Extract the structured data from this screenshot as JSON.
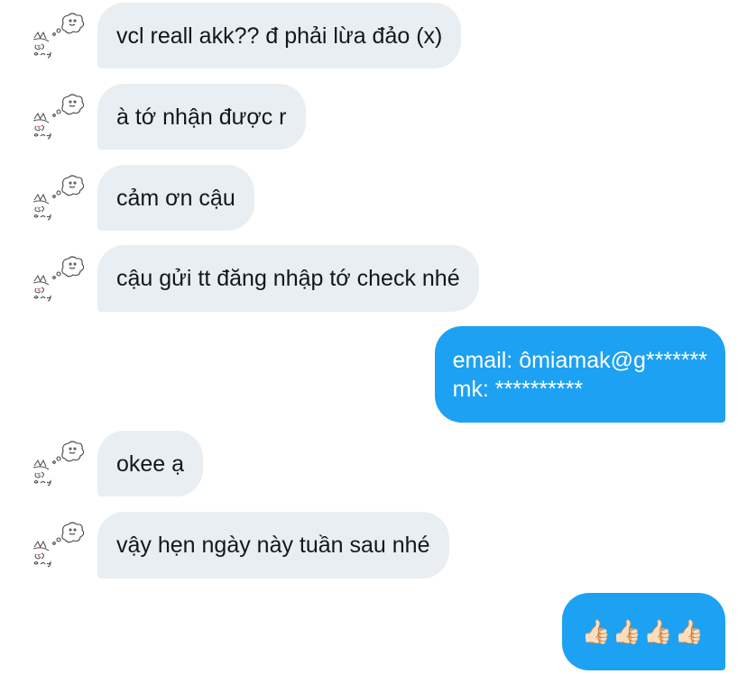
{
  "messages": [
    {
      "side": "incoming",
      "text": "vcl reall akk?? đ  phải lừa đảo (x)"
    },
    {
      "side": "incoming",
      "text": "à tớ nhận được r"
    },
    {
      "side": "incoming",
      "text": "cảm ơn cậu"
    },
    {
      "side": "incoming",
      "text": "cậu gửi tt đăng nhập tớ check nhé"
    },
    {
      "side": "outgoing",
      "lines": [
        "email: ômiamak@g*******",
        "mk: **********"
      ]
    },
    {
      "side": "incoming",
      "text": "okee ạ"
    },
    {
      "side": "incoming",
      "text": "vậy hẹn ngày này tuần sau nhé"
    },
    {
      "side": "outgoing",
      "text": "👍🏻👍🏻👍🏻👍🏻"
    }
  ],
  "colors": {
    "incoming_bubble": "#e9eef2",
    "outgoing_bubble": "#1da1f2",
    "incoming_text": "#14171a",
    "outgoing_text": "#ffffff"
  },
  "icons": {
    "avatar": "doodle-bunny-avatar-icon"
  }
}
